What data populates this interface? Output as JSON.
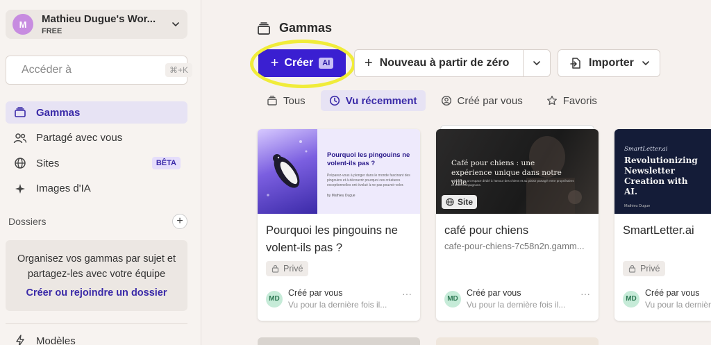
{
  "workspace": {
    "avatar": "M",
    "name": "Mathieu Dugue's Wor...",
    "plan": "FREE"
  },
  "search": {
    "placeholder": "Accéder à",
    "shortcut": "⌘+K"
  },
  "nav": {
    "items": [
      {
        "label": "Gammas",
        "icon": "stack-icon",
        "active": true
      },
      {
        "label": "Partagé avec vous",
        "icon": "users-icon"
      },
      {
        "label": "Sites",
        "icon": "globe-icon",
        "badge": "BÊTA"
      },
      {
        "label": "Images d'IA",
        "icon": "sparkle-icon"
      }
    ]
  },
  "folders": {
    "title": "Dossiers",
    "message": "Organisez vos gammas par sujet et partagez-les avec votre équipe",
    "link": "Créer ou rejoindre un dossier"
  },
  "models": {
    "label": "Modèles"
  },
  "main": {
    "title": "Gammas",
    "create_label": "Créer",
    "ai_badge": "AI",
    "new_label": "Nouveau à partir de zéro",
    "import_label": "Importer",
    "tabs": [
      {
        "label": "Tous",
        "icon": "stack-icon"
      },
      {
        "label": "Vu récemment",
        "icon": "clock-icon",
        "active": true
      },
      {
        "label": "Créé par vous",
        "icon": "user-circle-icon"
      },
      {
        "label": "Favoris",
        "icon": "star-icon"
      }
    ]
  },
  "cards": [
    {
      "title": "Pourquoi les pingouins ne volent-ils pas ?",
      "badge": "Privé",
      "thumb_heading": "Pourquoi les pingouins ne volent-ils pas ?",
      "thumb_text": "Préparez-vous à plonger dans le monde fascinant des pingouins et à découvrir pourquoi ces créatures exceptionnelles ont évolué à ne pas pouvoir voler.",
      "thumb_author": "by Mathieu Dugue",
      "created_by": "Créé par vous",
      "last_seen": "Vu pour la dernière fois il...",
      "avatar": "MD"
    },
    {
      "title": "café pour chiens",
      "subtitle": "cafe-pour-chiens-7c58n2n.gamm...",
      "thumb_heading": "Café pour chiens : une expérience unique dans notre ville",
      "thumb_text": "Découvrez un espace dédié à l'amour des chiens et au plaisir partagé entre propriétaires et leurs compagnons.",
      "site_badge": "Site",
      "created_by": "Créé par vous",
      "last_seen": "Vu pour la dernière fois il...",
      "avatar": "MD"
    },
    {
      "title": "SmartLetter.ai",
      "badge": "Privé",
      "thumb_brand": "SmartLetter.ai",
      "thumb_heading": "Revolutionizing Newsletter Creation with AI.",
      "thumb_author": "Mathieu Dugue",
      "created_by": "Créé par vous",
      "last_seen": "Vu pour la dernière fois il...",
      "avatar": "MD"
    }
  ],
  "colors": {
    "accent": "#3a1fd1",
    "highlight": "#f0ec3a",
    "active_bg": "#e7e3f4"
  }
}
